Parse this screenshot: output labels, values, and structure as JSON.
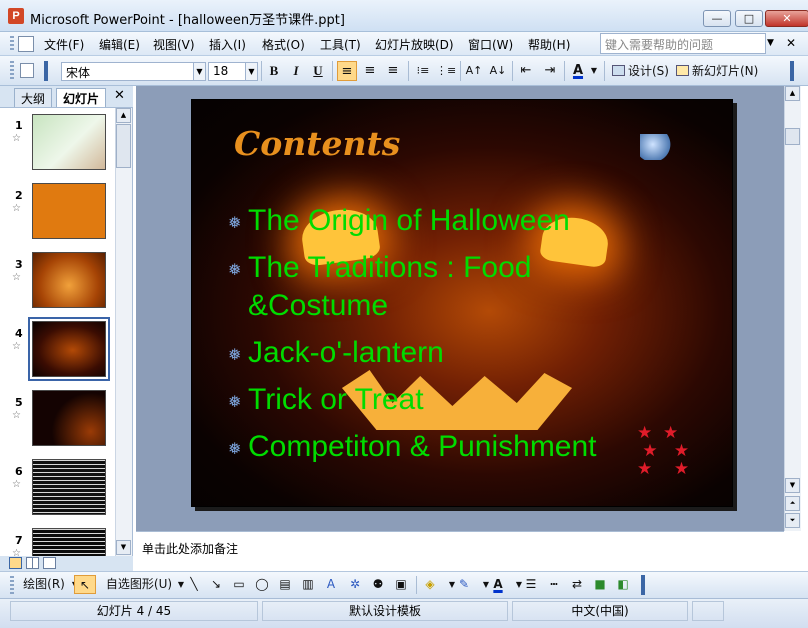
{
  "window": {
    "title": "Microsoft PowerPoint - [halloween万圣节课件.ppt]",
    "minimize": "—",
    "restore": "□",
    "close": "✕"
  },
  "menu": {
    "items": [
      "文件(F)",
      "编辑(E)",
      "视图(V)",
      "插入(I)",
      "格式(O)",
      "工具(T)",
      "幻灯片放映(D)",
      "窗口(W)",
      "帮助(H)"
    ],
    "help_placeholder": "键入需要帮助的问题",
    "help_dropdown": "▼",
    "close": "✕"
  },
  "toolbar": {
    "font_name": "宋体",
    "font_size": "18",
    "bold": "B",
    "italic": "I",
    "underline": "U",
    "align_left": "≡",
    "align_center": "≡",
    "align_right": "≡",
    "numbering": "⁝≡",
    "bullets": "⋮≡",
    "grow_font": "A↑",
    "shrink_font": "A↓",
    "decrease_indent": "⇤",
    "increase_indent": "⇥",
    "font_color": "A",
    "design_label": "设计(S)",
    "new_slide_label": "新幻灯片(N)",
    "dropdown": "▼"
  },
  "left_panel": {
    "tab_outline": "大纲",
    "tab_slides": "幻灯片",
    "close": "✕",
    "slides": [
      {
        "number": "1"
      },
      {
        "number": "2"
      },
      {
        "number": "3"
      },
      {
        "number": "4"
      },
      {
        "number": "5"
      },
      {
        "number": "6"
      },
      {
        "number": "7"
      }
    ],
    "star": "☆"
  },
  "slide": {
    "title": "Contents",
    "bullets": [
      "The Origin of Halloween",
      "The Traditions : Food &Costume",
      "Jack-o'-lantern",
      "Trick or Treat",
      "Competiton & Punishment"
    ],
    "bullet_icon": "❅",
    "bg_color": "#1a0502",
    "bullet_color": "#00dc00",
    "title_color": "#e8901e"
  },
  "notes": {
    "placeholder": "单击此处添加备注"
  },
  "draw_toolbar": {
    "draw_label": "绘图(R)",
    "autoshapes_label": "自选图形(U)",
    "dropdown": "▼"
  },
  "status": {
    "slide_info": "幻灯片 4 / 45",
    "template": "默认设计模板",
    "language": "中文(中国)"
  },
  "scrollbar": {
    "up": "▲",
    "down": "▼",
    "page_prev": "⏶",
    "page_next": "⏷"
  }
}
